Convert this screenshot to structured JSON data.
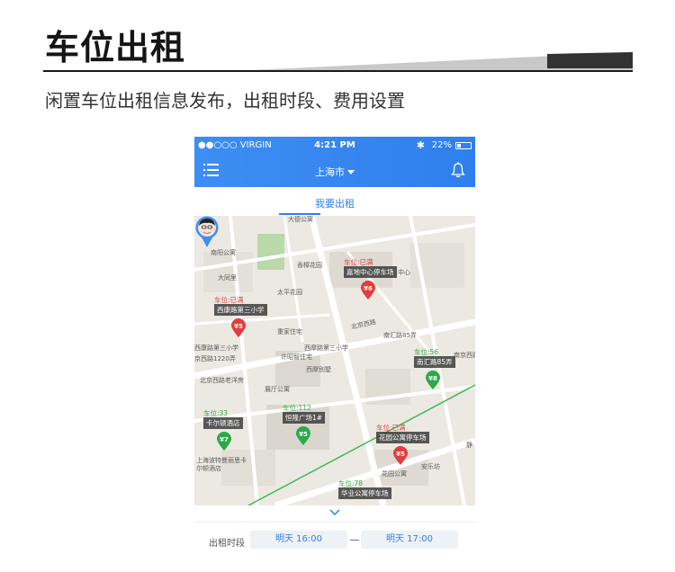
{
  "hero": {
    "title": "车位出租",
    "subtitle": "闲置车位出租信息发布，出租时段、费用设置"
  },
  "status_bar": {
    "carrier": "●●○○○ VIRGIN",
    "time": "4:21 PM",
    "battery": "22%"
  },
  "nav": {
    "city": "上海市"
  },
  "tabs": [
    {
      "label": "我要出租",
      "active": true
    }
  ],
  "map": {
    "labels": [
      "大德公寓",
      "南阳公寓",
      "大同里",
      "香樟花园",
      "太平花园",
      "西康路第三小学",
      "北京西路",
      "重家住宅",
      "西摩路第三小学",
      "许昭智住宅",
      "西摩别墅",
      "京西路1220弄",
      "北京西路老洋房",
      "展厅公寓",
      "南汇路85弄",
      "南京西路",
      "花园公寓",
      "安乐坊",
      "上海波特曼丽思卡尔顿酒店",
      "中心",
      "静"
    ],
    "pins": [
      {
        "status": "车位:已满",
        "name": "嘉地中心停车场",
        "price": "¥6",
        "color": "#e43b3b"
      },
      {
        "status": "车位:已满",
        "name": "西康路第三小学",
        "price": "¥5",
        "color": "#e43b3b"
      },
      {
        "status": "车位:56",
        "name": "南汇路85弄",
        "price": "¥8",
        "color": "#2da84a"
      },
      {
        "status": "车位:33",
        "name": "卡尔顿酒店",
        "price": "¥7",
        "color": "#2da84a"
      },
      {
        "status": "车位:112",
        "name": "恒隆广场1#",
        "price": "¥5",
        "color": "#2da84a"
      },
      {
        "status": "车位:已满",
        "name": "花园公寓停车场",
        "price": "¥5",
        "color": "#e43b3b"
      },
      {
        "status": "车位:78",
        "name": "华业公寓停车场",
        "price": "",
        "color": "#2da84a"
      }
    ]
  },
  "rental_time": {
    "label": "出租时段",
    "start": "明天  16:00",
    "end": "明天  17:00"
  },
  "colors": {
    "accent": "#2f7fee",
    "full": "#e43b3b",
    "available": "#2da84a"
  }
}
